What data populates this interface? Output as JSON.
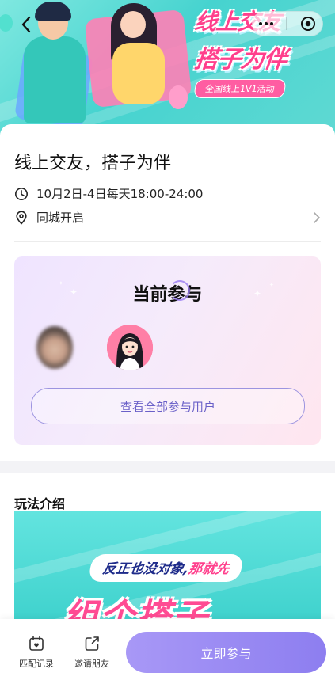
{
  "banner": {
    "art_line1": "线上交友",
    "art_line2": "搭子为伴",
    "art_pill": "全国线上1V1活动"
  },
  "event": {
    "title": "线上交友，搭子为伴",
    "time": "10月2日-4日每天18:00-24:00",
    "location": "同城开启"
  },
  "participants": {
    "title": "当前参与",
    "view_all_label": "查看全部参与用户"
  },
  "play_intro": {
    "title": "玩法介绍",
    "image_subtitle_a": "反正也没对象,",
    "image_subtitle_b": "那就先",
    "image_big_text": "组个搭子"
  },
  "bottom_bar": {
    "history_label": "匹配记录",
    "invite_label": "邀请朋友",
    "join_label": "立即参与"
  },
  "colors": {
    "accent": "#8d7ef0",
    "banner_bg": "#46d3cf",
    "brand_pink": "#ff3f8c"
  }
}
